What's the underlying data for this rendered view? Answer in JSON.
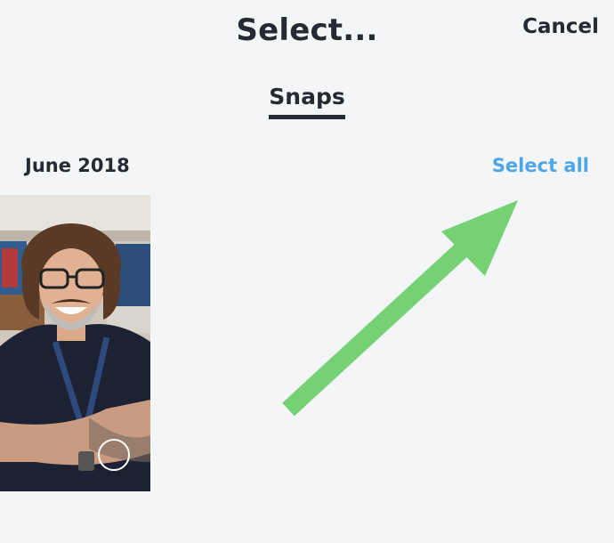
{
  "header": {
    "title": "Select...",
    "cancel_label": "Cancel"
  },
  "tabs": [
    {
      "label": "Snaps",
      "active": true
    }
  ],
  "section": {
    "title": "June 2018",
    "select_all_label": "Select all"
  },
  "snaps": [
    {
      "icon": "photo-thumbnail",
      "selected": false
    }
  ],
  "colors": {
    "accent_blue": "#4ea6e6",
    "arrow_green": "#76d174",
    "text_dark": "#262a33",
    "background": "#f4f5f7"
  }
}
